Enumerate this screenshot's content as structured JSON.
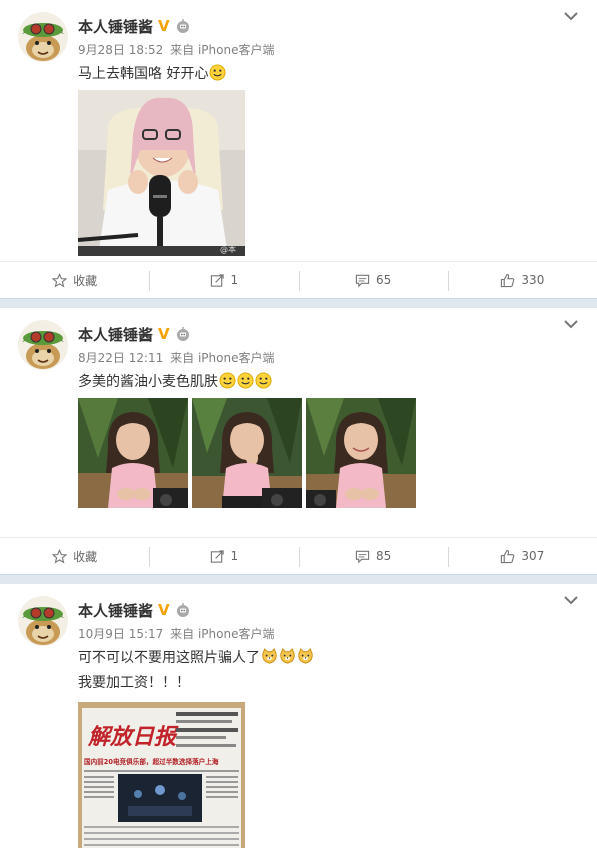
{
  "posts": [
    {
      "user": {
        "name": "本人锤锤酱",
        "verified_badge": "V"
      },
      "date": "9月28日 18:52",
      "source": "来自 iPhone客户端",
      "text": "马上去韩国咯 好开心",
      "emoji_count": 1,
      "images": [
        {
          "description": "photo-woman-microphone",
          "watermark": "@本"
        }
      ],
      "actions": {
        "favorite": "收藏",
        "repost": "1",
        "comment": "65",
        "like": "330"
      }
    },
    {
      "user": {
        "name": "本人锤锤酱",
        "verified_badge": "V"
      },
      "date": "8月22日 12:11",
      "source": "来自 iPhone客户端",
      "text": "多美的酱油小麦色肌肤",
      "emoji_count": 3,
      "images": [
        {
          "description": "photo-girl-pink-shirt-1"
        },
        {
          "description": "photo-girl-pink-shirt-2"
        },
        {
          "description": "photo-girl-pink-shirt-3"
        }
      ],
      "actions": {
        "favorite": "收藏",
        "repost": "1",
        "comment": "85",
        "like": "307"
      }
    },
    {
      "user": {
        "name": "本人锤锤酱",
        "verified_badge": "V"
      },
      "date": "10月9日 15:17",
      "source": "来自 iPhone客户端",
      "text_line1": "可不可以不要用这照片骗人了",
      "text_line2": "我要加工资！！！",
      "emoji_count": 3,
      "images": [
        {
          "description": "newspaper-photo",
          "masthead": "解放日报",
          "headline": "国内前20电竞俱乐部，超过半数选择落户上海"
        }
      ]
    }
  ],
  "colors": {
    "name": "#333333",
    "verified": "#f5a300",
    "meta": "#808080",
    "separator": "#dfe8ef"
  },
  "icons": {
    "more": "chevron-down-icon",
    "favorite": "star-icon",
    "repost": "repost-icon",
    "comment": "comment-icon",
    "like": "thumb-up-icon"
  }
}
